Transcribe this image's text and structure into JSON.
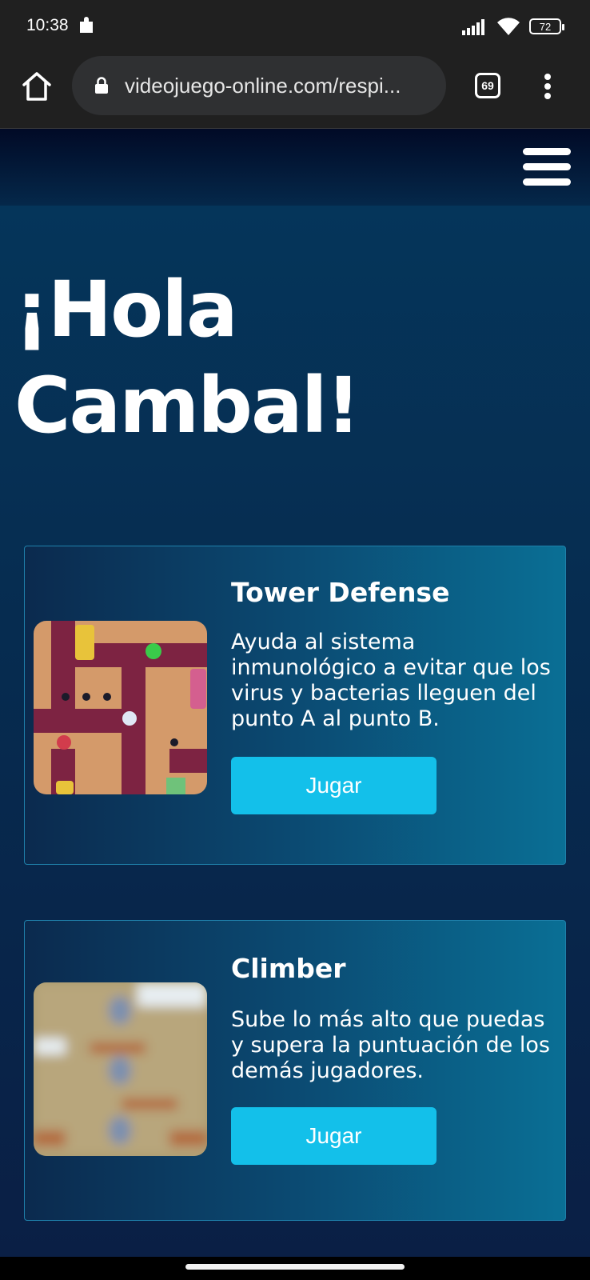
{
  "status_bar": {
    "time": "10:38",
    "battery": "72"
  },
  "browser": {
    "url": "videojuego-online.com/respi...",
    "tab_count": "69"
  },
  "main": {
    "greeting": "¡Hola Cambal!",
    "games": [
      {
        "title": "Tower Defense",
        "description": "Ayuda al sistema inmunológico a evitar que los virus y bacterias lleguen del punto A al punto B.",
        "button": "Jugar"
      },
      {
        "title": "Climber",
        "description": "Sube lo más alto que puedas y supera la puntuación de los demás jugadores.",
        "button": "Jugar"
      }
    ]
  },
  "colors": {
    "accent": "#13c0ea",
    "background": "#05223f",
    "card_border": "#1f80aa"
  }
}
